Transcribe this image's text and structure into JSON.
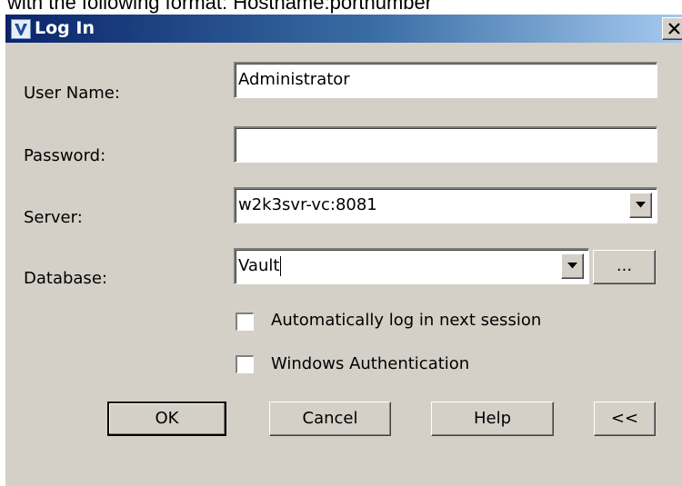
{
  "background_text": "with the following format: Hostname:portnumber",
  "window": {
    "title": "Log In",
    "icon": "vault-app-icon",
    "close_glyph": "✕"
  },
  "form": {
    "user_name": {
      "label": "User Name:",
      "value": "Administrator"
    },
    "password": {
      "label": "Password:",
      "value": ""
    },
    "server": {
      "label": "Server:",
      "value": "w2k3svr-vc:8081"
    },
    "database": {
      "label": "Database:",
      "value": "Vault",
      "browse_label": "..."
    },
    "auto_login": {
      "label": "Automatically log in next session",
      "checked": false
    },
    "windows_auth": {
      "label": "Windows Authentication",
      "checked": false
    }
  },
  "buttons": {
    "ok": "OK",
    "cancel": "Cancel",
    "help": "Help",
    "collapse": "<<"
  },
  "colors": {
    "dialog_bg": "#d4d0c8",
    "title_gradient_start": "#0a246a",
    "title_gradient_end": "#a6caf0"
  }
}
